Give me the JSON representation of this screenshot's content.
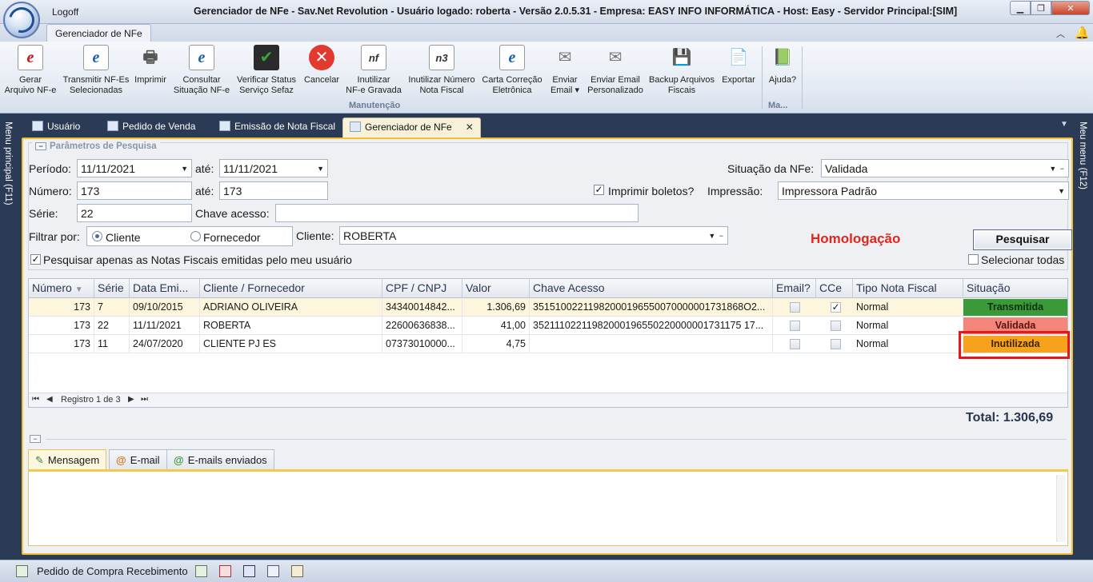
{
  "window": {
    "logoff": "Logoff",
    "title": "Gerenciador de NFe - Sav.Net Revolution - Usuário logado: roberta - Versão 2.0.5.31 - Empresa: EASY INFO INFORMÁTICA - Host: Easy - Servidor Principal:[SIM]",
    "min_glyph": "▁",
    "max_glyph": "❐",
    "close_glyph": "✕"
  },
  "ribbon": {
    "tab": "Gerenciador de NFe",
    "collapse_glyph": "︿",
    "bell_glyph": "🔔",
    "buttons": [
      {
        "l1": "Gerar",
        "l2": "Arquivo NF-e",
        "icon": "e"
      },
      {
        "l1": "Transmitir NF-Es",
        "l2": "Selecionadas",
        "icon": "e"
      },
      {
        "l1": "Imprimir",
        "l2": "",
        "icon": "🖶"
      },
      {
        "l1": "Consultar",
        "l2": "Situação NF-e",
        "icon": "e"
      },
      {
        "l1": "Verificar Status",
        "l2": "Serviço Sefaz",
        "icon": "✔"
      },
      {
        "l1": "Cancelar",
        "l2": "",
        "icon": "✕"
      },
      {
        "l1": "Inutilizar",
        "l2": "NF-e Gravada",
        "icon": "nf"
      },
      {
        "l1": "Inutilizar Número",
        "l2": "Nota Fiscal",
        "icon": "n3"
      },
      {
        "l1": "Carta Correção",
        "l2": "Eletrônica",
        "icon": "e"
      },
      {
        "l1": "Enviar",
        "l2": "Email ▾",
        "icon": "✉"
      },
      {
        "l1": "Enviar Email",
        "l2": "Personalizado",
        "icon": "✉"
      },
      {
        "l1": "Backup Arquivos",
        "l2": "Fiscais",
        "icon": "💾"
      },
      {
        "l1": "Exportar",
        "l2": "",
        "icon": "📄"
      },
      {
        "l1": "Ajuda?",
        "l2": "",
        "icon": "📗"
      }
    ],
    "group_main": "Manutenção",
    "group_help": "Ma..."
  },
  "rails": {
    "left": "Menu principal (F11)",
    "right": "Meu menu (F12)"
  },
  "doc_tabs": [
    {
      "label": "Usuário"
    },
    {
      "label": "Pedido de Venda"
    },
    {
      "label": "Emissão de Nota Fiscal"
    },
    {
      "label": "Gerenciador de NFe",
      "close": "✕"
    }
  ],
  "search": {
    "legend": "Parâmetros de Pesquisa",
    "periodo_label": "Período:",
    "periodo_de": "11/11/2021",
    "ate_label": "até:",
    "periodo_ate": "11/11/2021",
    "situacao_label": "Situação da NFe:",
    "situacao": "Validada",
    "numero_label": "Número:",
    "numero_de": "173",
    "numero_ate": "173",
    "imprimir_boletos_label": "Imprimir boletos?",
    "impressao_label": "Impressão:",
    "impressao": "Impressora Padrão",
    "serie_label": "Série:",
    "serie": "22",
    "chave_label": "Chave acesso:",
    "chave": "",
    "filtrar_label": "Filtrar por:",
    "radio_cliente": "Cliente",
    "radio_fornecedor": "Fornecedor",
    "cliente_label": "Cliente:",
    "cliente": "ROBERTA",
    "homologacao": "Homologação",
    "pesquisar": "Pesquisar",
    "apenas_usuario": "Pesquisar apenas as Notas Fiscais emitidas pelo meu usuário",
    "selecionar_todas": "Selecionar todas",
    "check_mark": "✓"
  },
  "grid": {
    "columns": [
      "Número",
      "Série",
      "Data Emi...",
      "Cliente / Fornecedor",
      "CPF / CNPJ",
      "Valor",
      "Chave Acesso",
      "Email?",
      "CCe",
      "Tipo Nota Fiscal",
      "Situação"
    ],
    "sort_glyph": "▼",
    "rows": [
      {
        "numero": "173",
        "serie": "7",
        "data": "09/10/2015",
        "cliente": "ADRIANO OLIVEIRA",
        "cpf": "34340014842...",
        "valor": "1.306,69",
        "chave": "35151002211982000196550070000001731868O2...",
        "email": "",
        "cce": "✓",
        "tipo": "Normal",
        "situacao": "Transmitida"
      },
      {
        "numero": "173",
        "serie": "22",
        "data": "11/11/2021",
        "cliente": "ROBERTA",
        "cpf": "22600636838...",
        "valor": "41,00",
        "chave": "35211102211982000196550220000001731175 17...",
        "email": "",
        "cce": "",
        "tipo": "Normal",
        "situacao": "Validada"
      },
      {
        "numero": "173",
        "serie": "11",
        "data": "24/07/2020",
        "cliente": "CLIENTE PJ ES",
        "cpf": "07373010000...",
        "valor": "4,75",
        "chave": "",
        "email": "",
        "cce": "",
        "tipo": "Normal",
        "situacao": "Inutilizada"
      }
    ],
    "status_colors": {
      "Transmitida": "#3a9a3a",
      "Validada": "#f4857a",
      "Inutilizada": "#f7a21b"
    },
    "footer": {
      "first": "⏮",
      "prev": "◀",
      "record": "Registro 1 de 3",
      "next": "▶",
      "last": "⏭"
    }
  },
  "total": "Total: 1.306,69",
  "bottom_tabs": [
    {
      "label": "Mensagem",
      "icon": "✎"
    },
    {
      "label": "E-mail",
      "icon": "@"
    },
    {
      "label": "E-mails enviados",
      "icon": "@"
    }
  ],
  "statusbar": {
    "pedido_compra": "Pedido de Compra",
    "recebimento": "Recebimento"
  }
}
